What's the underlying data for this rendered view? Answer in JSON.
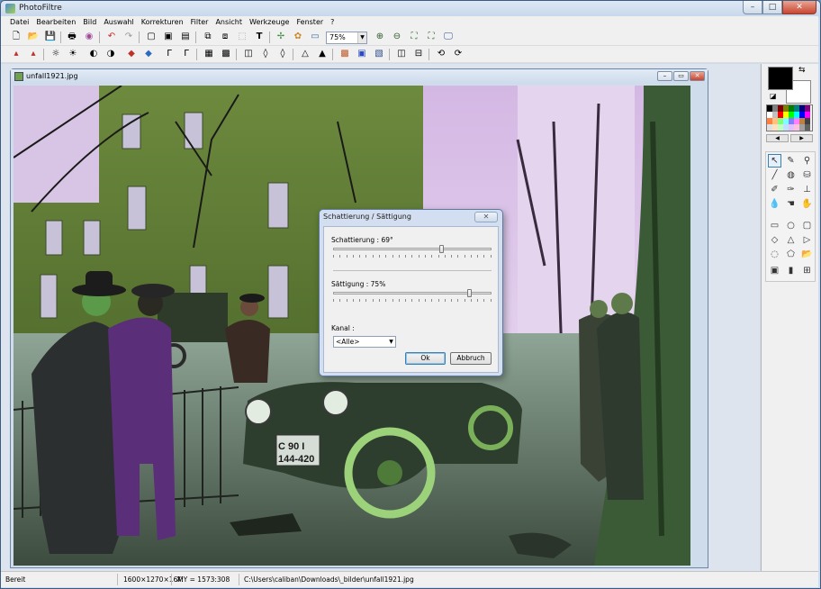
{
  "app": {
    "title": "PhotoFiltre"
  },
  "window_controls": {
    "minimize": "–",
    "maximize": "□",
    "close": "✕"
  },
  "menu": [
    "Datei",
    "Bearbeiten",
    "Bild",
    "Auswahl",
    "Korrekturen",
    "Filter",
    "Ansicht",
    "Werkzeuge",
    "Fenster",
    "?"
  ],
  "toolbar": {
    "zoom": "75%"
  },
  "document": {
    "name": "unfall1921.jpg",
    "controls": {
      "minimize": "–",
      "maximize": "▭",
      "close": "✕"
    }
  },
  "image": {
    "plates": {
      "top": "C 90 I",
      "bottom": "144-420"
    }
  },
  "dialog": {
    "title": "Schattierung / Sättigung",
    "close": "✕",
    "hue_label": "Schattierung : 69°",
    "hue_value": 69,
    "hue_range": [
      -180,
      180
    ],
    "saturation_label": "Sättigung : 75%",
    "saturation_value": 75,
    "saturation_range": [
      -100,
      100
    ],
    "channel_label": "Kanal :",
    "channel_value": "<Alle>",
    "ok": "Ok",
    "cancel": "Abbruch"
  },
  "right_panel": {
    "foreground_color": "#000000",
    "background_color": "#ffffff"
  },
  "statusbar": {
    "state": "Bereit",
    "dimensions": "1600×1270×16M",
    "coords": "X:Y = 1573:308",
    "path": "C:\\Users\\caliban\\Downloads\\_bilder\\unfall1921.jpg"
  }
}
